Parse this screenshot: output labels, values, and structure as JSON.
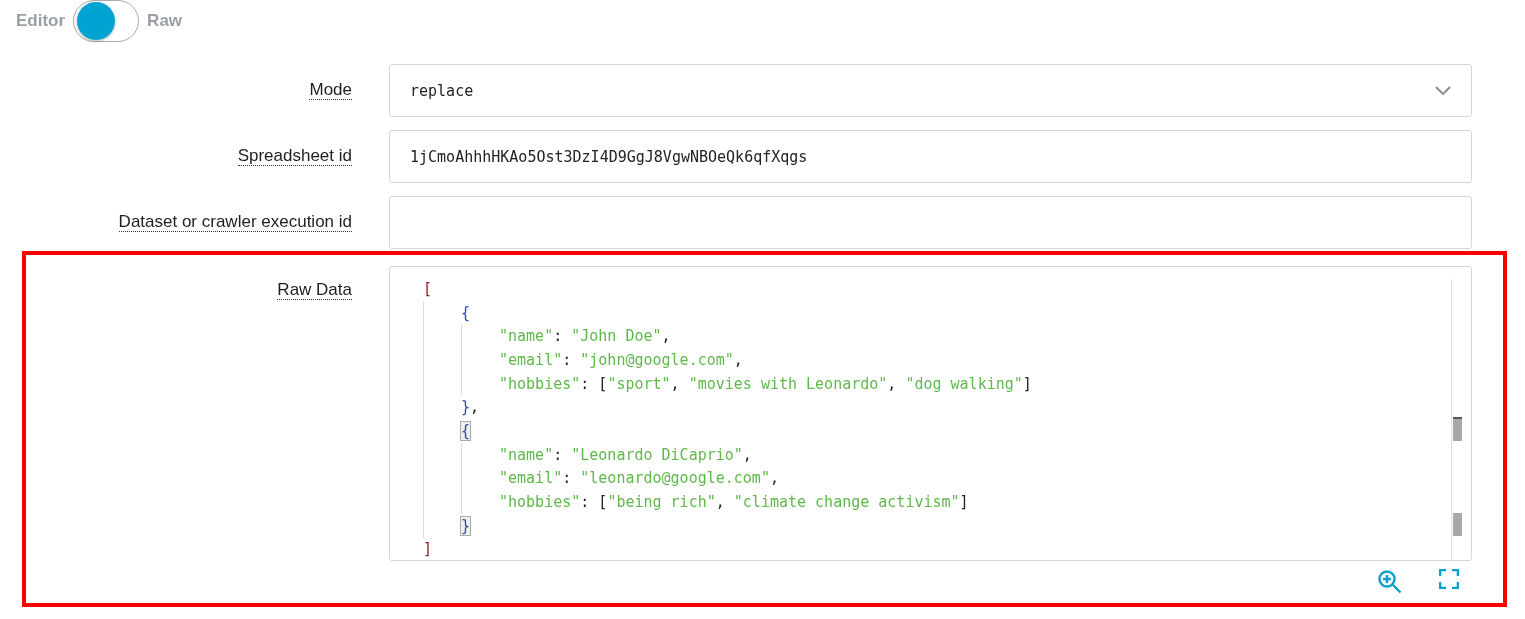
{
  "toggle": {
    "left_label": "Editor",
    "right_label": "Raw",
    "on": true
  },
  "fields": [
    {
      "kind": "select",
      "label": "Mode",
      "value": "replace"
    },
    {
      "kind": "text",
      "label": "Spreadsheet id",
      "value": "1jCmoAhhhHKAo5Ost3DzI4D9GgJ8VgwNBOeQk6qfXqgs"
    },
    {
      "kind": "text",
      "label": "Dataset or crawler execution id"
    }
  ],
  "raw_data": {
    "label": "Raw Data",
    "highlighted": true,
    "code": {
      "open": [
        {
          "kind": "bracket",
          "text": "[",
          "matched": false
        }
      ],
      "close": [
        {
          "kind": "bracket",
          "text": "]",
          "matched": false
        }
      ],
      "children": [
        {
          "open": [
            {
              "kind": "bracket",
              "text": "{",
              "matched": false
            }
          ],
          "close": [
            {
              "kind": "bracket",
              "text": "}",
              "matched": false
            },
            {
              "kind": "punct",
              "text": ","
            }
          ],
          "children": [
            {
              "tokens": [
                {
                  "kind": "key",
                  "text": "\"name\""
                },
                {
                  "kind": "punct",
                  "text": ": "
                },
                {
                  "kind": "string",
                  "text": "\"John Doe\""
                },
                {
                  "kind": "punct",
                  "text": ","
                }
              ]
            },
            {
              "tokens": [
                {
                  "kind": "key",
                  "text": "\"email\""
                },
                {
                  "kind": "punct",
                  "text": ": "
                },
                {
                  "kind": "string",
                  "text": "\"john@google.com\""
                },
                {
                  "kind": "punct",
                  "text": ","
                }
              ]
            },
            {
              "tokens": [
                {
                  "kind": "key",
                  "text": "\"hobbies\""
                },
                {
                  "kind": "punct",
                  "text": ": ["
                },
                {
                  "kind": "string",
                  "text": "\"sport\""
                },
                {
                  "kind": "punct",
                  "text": ", "
                },
                {
                  "kind": "string",
                  "text": "\"movies with Leonardo\""
                },
                {
                  "kind": "punct",
                  "text": ", "
                },
                {
                  "kind": "string",
                  "text": "\"dog walking\""
                },
                {
                  "kind": "punct",
                  "text": "]"
                }
              ]
            }
          ]
        },
        {
          "open": [
            {
              "kind": "bracket",
              "text": "{",
              "matched": true
            }
          ],
          "close": [
            {
              "kind": "bracket",
              "text": "}",
              "matched": true
            }
          ],
          "children": [
            {
              "tokens": [
                {
                  "kind": "key",
                  "text": "\"name\""
                },
                {
                  "kind": "punct",
                  "text": ": "
                },
                {
                  "kind": "string",
                  "text": "\"Leonardo DiCaprio\""
                },
                {
                  "kind": "punct",
                  "text": ","
                }
              ]
            },
            {
              "tokens": [
                {
                  "kind": "key",
                  "text": "\"email\""
                },
                {
                  "kind": "punct",
                  "text": ": "
                },
                {
                  "kind": "string",
                  "text": "\"leonardo@google.com\""
                },
                {
                  "kind": "punct",
                  "text": ","
                }
              ]
            },
            {
              "tokens": [
                {
                  "kind": "key",
                  "text": "\"hobbies\""
                },
                {
                  "kind": "punct",
                  "text": ": ["
                },
                {
                  "kind": "string",
                  "text": "\"being rich\""
                },
                {
                  "kind": "punct",
                  "text": ", "
                },
                {
                  "kind": "string",
                  "text": "\"climate change activism\""
                },
                {
                  "kind": "punct",
                  "text": "]"
                }
              ]
            }
          ]
        }
      ]
    }
  }
}
